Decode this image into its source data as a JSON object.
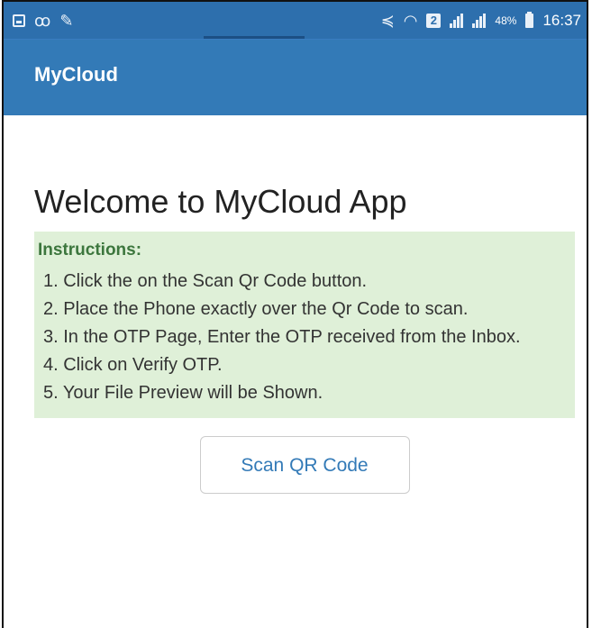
{
  "status_bar": {
    "left_icons": [
      "gallery-icon",
      "voicemail-icon",
      "mute-icon"
    ],
    "right_icons": [
      "vibrate-icon",
      "wifi-icon",
      "sim-icon",
      "signal-icon",
      "signal-icon",
      "battery-icon"
    ],
    "sim_badge": "2",
    "battery_percent": "48%",
    "time": "16:37"
  },
  "app_bar": {
    "title": "MyCloud"
  },
  "main": {
    "welcome": "Welcome to MyCloud App",
    "instructions": {
      "heading": "Instructions:",
      "steps": [
        "1. Click the on the Scan Qr Code button.",
        "2. Place the Phone exactly over the Qr Code to scan.",
        "3. In the OTP Page, Enter the OTP received from the Inbox.",
        "4. Click on Verify OTP.",
        "5. Your File Preview will be Shown."
      ]
    },
    "scan_button_label": "Scan QR Code"
  },
  "colors": {
    "status_bar": "#2d6fad",
    "app_bar": "#337ab7",
    "panel_bg": "#dff0d8",
    "heading_green": "#3c763d",
    "link_blue": "#337ab7"
  }
}
